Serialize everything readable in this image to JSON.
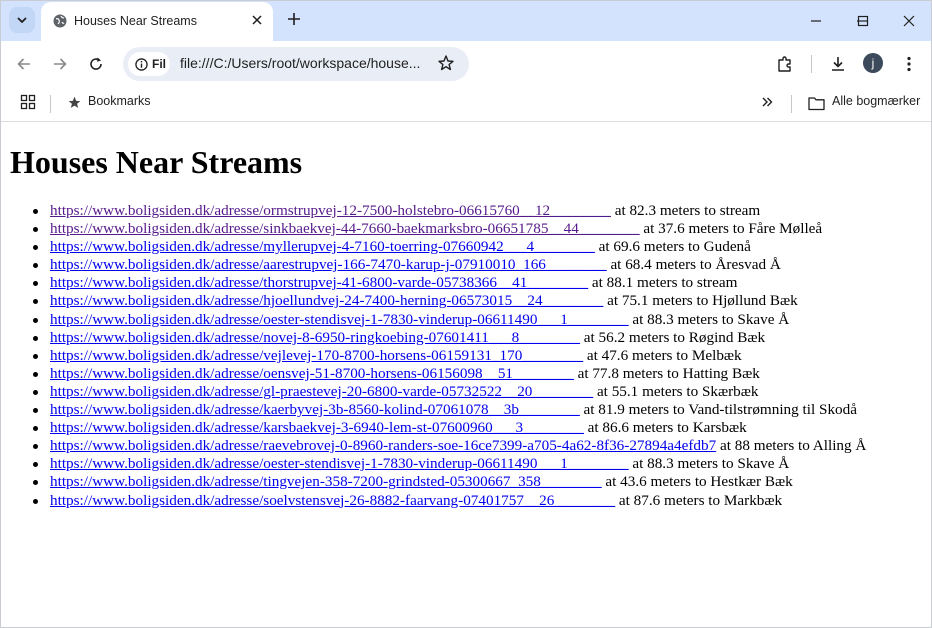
{
  "browser": {
    "tab_title": "Houses Near Streams",
    "address_chip": "Fil",
    "url": "file:///C:/Users/root/workspace/house...",
    "bookmarks_label": "Bookmarks",
    "all_bookmarks_label": "Alle bogmærker",
    "avatar_letter": "j"
  },
  "page": {
    "heading": "Houses Near Streams",
    "items": [
      {
        "url": "https://www.boligsiden.dk/adresse/ormstrupvej-12-7500-holstebro-06615760__12________",
        "suffix": " at 82.3 meters to stream",
        "visited": true
      },
      {
        "url": "https://www.boligsiden.dk/adresse/sinkbaekvej-44-7660-baekmarksbro-06651785__44________",
        "suffix": " at 37.6 meters to Fåre Mølleå",
        "visited": true
      },
      {
        "url": "https://www.boligsiden.dk/adresse/myllerupvej-4-7160-toerring-07660942___4________",
        "suffix": " at 69.6 meters to Gudenå",
        "visited": false
      },
      {
        "url": "https://www.boligsiden.dk/adresse/aarestrupvej-166-7470-karup-j-07910010_166________",
        "suffix": " at 68.4 meters to Åresvad Å",
        "visited": false
      },
      {
        "url": "https://www.boligsiden.dk/adresse/thorstrupvej-41-6800-varde-05738366__41________",
        "suffix": " at 88.1 meters to stream",
        "visited": false
      },
      {
        "url": "https://www.boligsiden.dk/adresse/hjoellundvej-24-7400-herning-06573015__24________",
        "suffix": " at 75.1 meters to Hjøllund Bæk",
        "visited": false
      },
      {
        "url": "https://www.boligsiden.dk/adresse/oester-stendisvej-1-7830-vinderup-06611490___1________",
        "suffix": " at 88.3 meters to Skave Å",
        "visited": false
      },
      {
        "url": "https://www.boligsiden.dk/adresse/novej-8-6950-ringkoebing-07601411___8________",
        "suffix": " at 56.2 meters to Røgind Bæk",
        "visited": false
      },
      {
        "url": "https://www.boligsiden.dk/adresse/vejlevej-170-8700-horsens-06159131_170________",
        "suffix": " at 47.6 meters to Melbæk",
        "visited": false
      },
      {
        "url": "https://www.boligsiden.dk/adresse/oensvej-51-8700-horsens-06156098__51________",
        "suffix": " at 77.8 meters to Hatting Bæk",
        "visited": false
      },
      {
        "url": "https://www.boligsiden.dk/adresse/gl-praestevej-20-6800-varde-05732522__20________",
        "suffix": " at 55.1 meters to Skærbæk",
        "visited": false
      },
      {
        "url": "https://www.boligsiden.dk/adresse/kaerbyvej-3b-8560-kolind-07061078__3b________",
        "suffix": " at 81.9 meters to Vand-tilstrømning til Skodå",
        "visited": false
      },
      {
        "url": "https://www.boligsiden.dk/adresse/karsbaekvej-3-6940-lem-st-07600960___3________",
        "suffix": " at 86.6 meters to Karsbæk",
        "visited": false
      },
      {
        "url": "https://www.boligsiden.dk/adresse/raevebrovej-0-8960-randers-soe-16ce7399-a705-4a62-8f36-27894a4efdb7",
        "suffix": " at 88 meters to Alling Å",
        "visited": false
      },
      {
        "url": "https://www.boligsiden.dk/adresse/oester-stendisvej-1-7830-vinderup-06611490___1________",
        "suffix": " at 88.3 meters to Skave Å",
        "visited": false
      },
      {
        "url": "https://www.boligsiden.dk/adresse/tingvejen-358-7200-grindsted-05300667_358________",
        "suffix": " at 43.6 meters to Hestkær Bæk",
        "visited": false
      },
      {
        "url": "https://www.boligsiden.dk/adresse/soelvstensvej-26-8882-faarvang-07401757__26________",
        "suffix": " at 87.6 meters to Markbæk",
        "visited": false
      }
    ]
  }
}
